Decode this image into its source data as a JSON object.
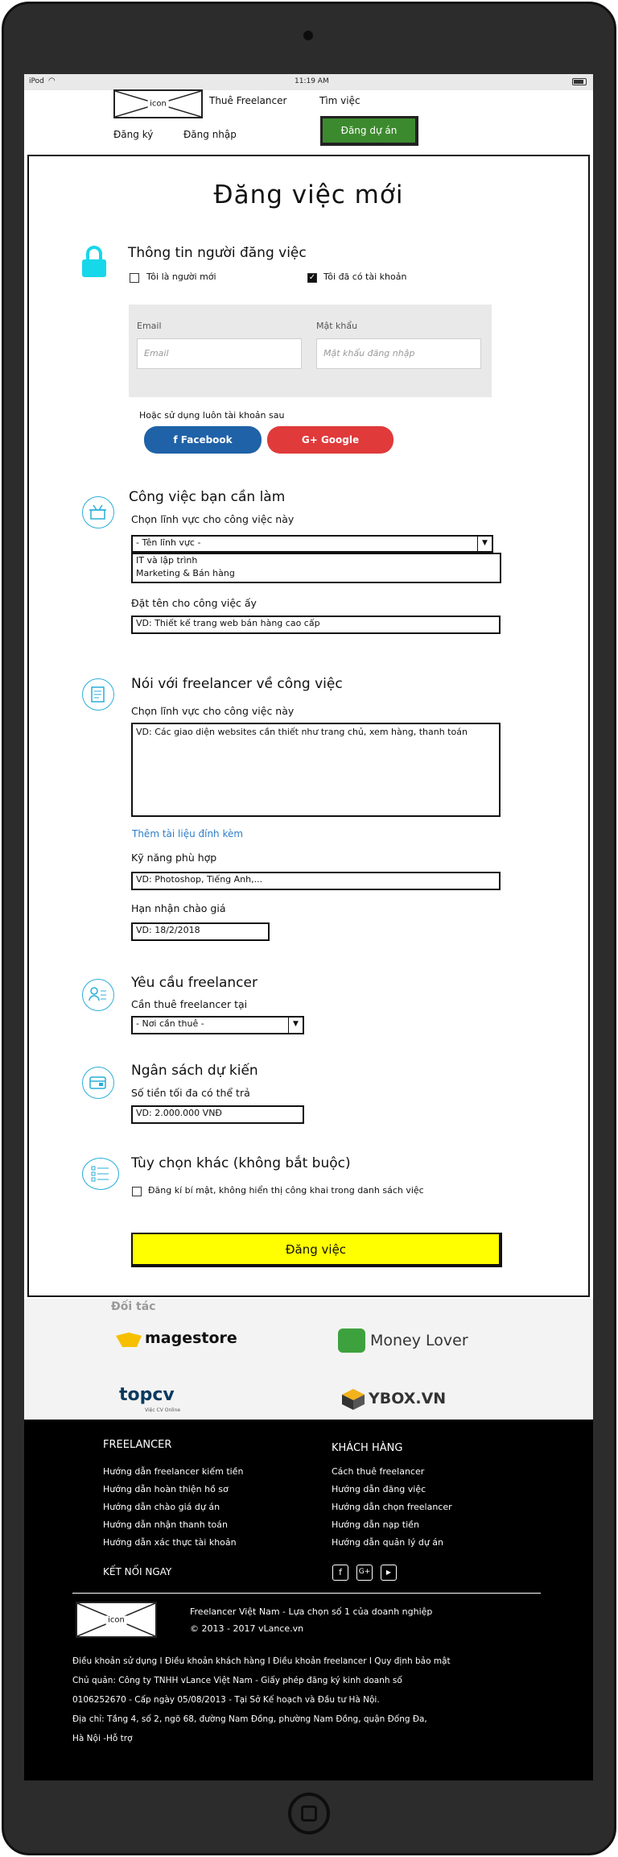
{
  "status_bar": {
    "carrier": "iPod",
    "time": "11:19 AM"
  },
  "header": {
    "logo_label": "icon",
    "nav_hire": "Thuê Freelancer",
    "nav_find": "Tìm việc",
    "nav_register": "Đăng ký",
    "nav_login": "Đăng nhập",
    "post_button": "Đăng dự án"
  },
  "page_title": "Đăng việc mới",
  "poster_section": {
    "title": "Thông tin người đăng việc",
    "new_user_label": "Tôi là người mới",
    "has_account_label": "Tôi đã có tài khoản",
    "has_account_checked": true,
    "email_label": "Email",
    "email_placeholder": "Email",
    "password_label": "Mật khẩu",
    "password_placeholder": "Mật khẩu đăng nhập",
    "or_use": "Hoặc sử dụng luôn tài khoản sau",
    "facebook": "Facebook",
    "google": "Google"
  },
  "job_section": {
    "title": "Công việc bạn cần làm",
    "field_label": "Chọn lĩnh vực cho công việc này",
    "field_selected": "- Tên lĩnh vực -",
    "field_options": [
      "IT và lập trình",
      "Marketing & Bán hàng"
    ],
    "name_label": "Đặt tên cho công việc ấy",
    "name_value": "VD: Thiết kế trang web bán hàng cao cấp"
  },
  "describe_section": {
    "title": "Nói với freelancer về công việc",
    "desc_label": "Chọn lĩnh vực cho công việc này",
    "desc_value": "VD: Các giao diện websites cần thiết như trang chủ, xem hàng, thanh toán",
    "attach_link": "Thêm tài liệu đính kèm",
    "skills_label": "Kỹ năng phù hợp",
    "skills_value": "VD: Photoshop, Tiếng Anh,...",
    "deadline_label": "Hạn nhận chào giá",
    "deadline_value": "VD: 18/2/2018"
  },
  "require_section": {
    "title": "Yêu cầu freelancer",
    "location_label": "Cần thuê freelancer tại",
    "location_selected": "- Nơi cần thuê -"
  },
  "budget_section": {
    "title": "Ngân sách dự kiến",
    "max_label": "Số tiền tối đa có thể trả",
    "max_value": "VD: 2.000.000 VNĐ"
  },
  "options_section": {
    "title": "Tùy chọn khác (không bắt buộc)",
    "private_label": "Đăng kí bí mật, không hiển thị công khai trong danh sách việc"
  },
  "submit_label": "Đăng việc",
  "partners": {
    "title": "Đối tác",
    "items": [
      "magestore",
      "Money Lover",
      "topcv",
      "YBOX.VN"
    ],
    "topcv_tagline": "Việc CV Online"
  },
  "footer": {
    "freelancer_title": "FREELANCER",
    "freelancer_links": [
      "Hướng dẫn freelancer kiếm tiền",
      "Hướng dẫn hoàn thiện hồ sơ",
      "Hướng dẫn chào giá dự án",
      "Hướng dẫn nhận thanh toán",
      "Hướng dẫn xác thực tài khoản"
    ],
    "client_title": "KHÁCH HÀNG",
    "client_links": [
      "Cách thuê freelancer",
      "Hướng dẫn đăng việc",
      "Hướng dẫn chọn freelancer",
      "Hướng dẫn nạp tiền",
      "Hướng dẫn quản lý dự án"
    ],
    "connect": "KẾT NỐI NGAY",
    "logo_label": "icon",
    "tagline": "Freelancer Việt Nam - Lựa chọn số 1 của doanh nghiệp",
    "copyright": "© 2013 - 2017 vLance.vn",
    "terms": "Điều khoản sử dụng I Điều khoản khách hàng I Điều khoản freelancer I Quy định bảo mật",
    "owner": "Chủ quản: Công ty TNHH vLance Việt Nam - Giấy phép đăng ký kinh doanh số",
    "license": "0106252670 - Cấp ngày 05/08/2013 - Tại Sở Kế hoạch và Đầu tư Hà Nội.",
    "address1": "Địa chỉ: Tầng 4, số 2, ngõ 68, đường Nam Đồng, phường Nam Đồng, quận Đống Đa,",
    "address2": "Hà Nội -Hỗ trợ"
  }
}
